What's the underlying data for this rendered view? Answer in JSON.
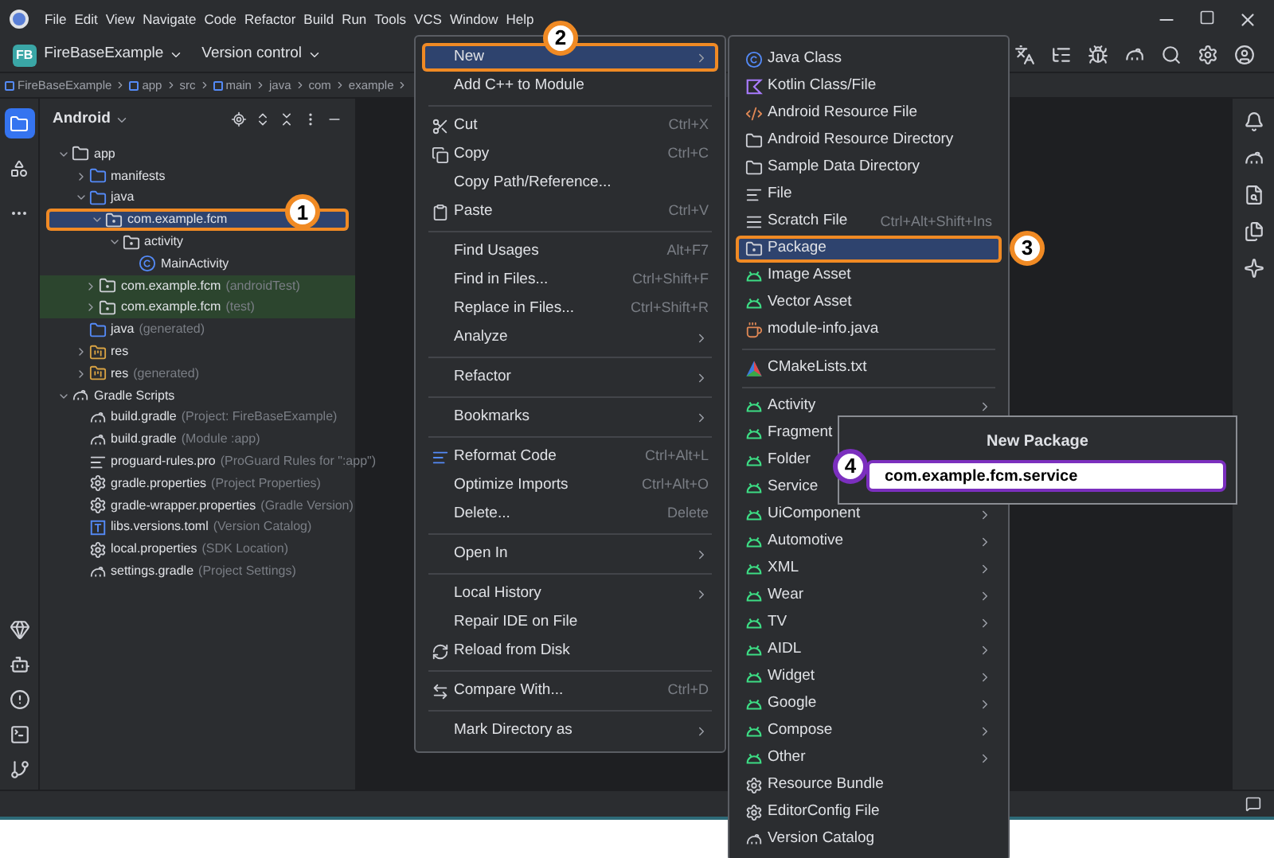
{
  "menu_bar": [
    "File",
    "Edit",
    "View",
    "Navigate",
    "Code",
    "Refactor",
    "Build",
    "Run",
    "Tools",
    "VCS",
    "Window",
    "Help"
  ],
  "toolbar": {
    "project_badge": "FB",
    "project": "FireBaseExample",
    "vcs": "Version control"
  },
  "breadcrumbs": [
    {
      "label": "FireBaseExample",
      "module": true
    },
    {
      "label": "app",
      "module": true
    },
    {
      "label": "src",
      "module": false
    },
    {
      "label": "main",
      "module": true
    },
    {
      "label": "java",
      "module": false
    },
    {
      "label": "com",
      "module": false
    },
    {
      "label": "example",
      "module": false
    }
  ],
  "left_toolbar": [
    {
      "kind": "project",
      "selected": true
    },
    {
      "kind": "structure",
      "selected": false
    },
    {
      "kind": "more",
      "selected": false
    }
  ],
  "project_panel": {
    "title": "Android",
    "tree": [
      {
        "label": "app",
        "kind": "module",
        "expanded": true,
        "children": [
          {
            "label": "manifests",
            "kind": "folder",
            "expanded": false
          },
          {
            "label": "java",
            "kind": "folder",
            "expanded": true,
            "children": [
              {
                "label": "com.example.fcm",
                "kind": "package",
                "expanded": true,
                "selected": true,
                "callout": {
                  "label": "1",
                  "color": "#f08a24"
                },
                "children": [
                  {
                    "label": "activity",
                    "kind": "package",
                    "expanded": true,
                    "children": [
                      {
                        "label": "MainActivity",
                        "kind": "class"
                      }
                    ]
                  }
                ]
              },
              {
                "label": "com.example.fcm",
                "hint": "(androidTest)",
                "kind": "package",
                "expanded": false,
                "highlighted": true
              },
              {
                "label": "com.example.fcm",
                "hint": "(test)",
                "kind": "package",
                "expanded": false,
                "highlighted": true
              }
            ]
          },
          {
            "label": "java",
            "hint": "(generated)",
            "kind": "folder"
          },
          {
            "label": "res",
            "kind": "res",
            "expanded": false
          },
          {
            "label": "res",
            "hint": "(generated)",
            "kind": "res",
            "expanded": false
          }
        ]
      },
      {
        "label": "Gradle Scripts",
        "kind": "gradle",
        "expanded": true,
        "children": [
          {
            "label": "build.gradle",
            "hint": "(Project: FireBaseExample)",
            "kind": "gradle"
          },
          {
            "label": "build.gradle",
            "hint": "(Module :app)",
            "kind": "gradle"
          },
          {
            "label": "proguard-rules.pro",
            "hint": "(ProGuard Rules for \":app\")",
            "kind": "file"
          },
          {
            "label": "gradle.properties",
            "hint": "(Project Properties)",
            "kind": "settings"
          },
          {
            "label": "gradle-wrapper.properties",
            "hint": "(Gradle Version)",
            "kind": "settings"
          },
          {
            "label": "libs.versions.toml",
            "hint": "(Version Catalog)",
            "kind": "toml"
          },
          {
            "label": "local.properties",
            "hint": "(SDK Location)",
            "kind": "settings"
          },
          {
            "label": "settings.gradle",
            "hint": "(Project Settings)",
            "kind": "gradle"
          }
        ]
      }
    ]
  },
  "context_menu": [
    {
      "kind": "plain",
      "label": "New",
      "submenu": true,
      "selected": true,
      "callout": {
        "label": "2",
        "color": "#f08a24"
      }
    },
    {
      "kind": "plain",
      "label": "Add C++ to Module"
    },
    {
      "kind": "separator"
    },
    {
      "kind": "cut",
      "label": "Cut",
      "shortcut": "Ctrl+X"
    },
    {
      "kind": "copy",
      "label": "Copy",
      "shortcut": "Ctrl+C"
    },
    {
      "kind": "plain",
      "label": "Copy Path/Reference..."
    },
    {
      "kind": "paste",
      "label": "Paste",
      "shortcut": "Ctrl+V"
    },
    {
      "kind": "separator"
    },
    {
      "kind": "plain",
      "label": "Find Usages",
      "shortcut": "Alt+F7"
    },
    {
      "kind": "plain",
      "label": "Find in Files...",
      "shortcut": "Ctrl+Shift+F"
    },
    {
      "kind": "plain",
      "label": "Replace in Files...",
      "shortcut": "Ctrl+Shift+R"
    },
    {
      "kind": "plain",
      "label": "Analyze",
      "submenu": true
    },
    {
      "kind": "separator"
    },
    {
      "kind": "plain",
      "label": "Refactor",
      "submenu": true
    },
    {
      "kind": "separator"
    },
    {
      "kind": "plain",
      "label": "Bookmarks",
      "submenu": true
    },
    {
      "kind": "separator"
    },
    {
      "kind": "reformat",
      "label": "Reformat Code",
      "shortcut": "Ctrl+Alt+L"
    },
    {
      "kind": "plain",
      "label": "Optimize Imports",
      "shortcut": "Ctrl+Alt+O"
    },
    {
      "kind": "plain",
      "label": "Delete...",
      "shortcut": "Delete"
    },
    {
      "kind": "separator"
    },
    {
      "kind": "plain",
      "label": "Open In",
      "submenu": true
    },
    {
      "kind": "separator"
    },
    {
      "kind": "plain",
      "label": "Local History",
      "submenu": true
    },
    {
      "kind": "plain",
      "label": "Repair IDE on File"
    },
    {
      "kind": "reload",
      "label": "Reload from Disk"
    },
    {
      "kind": "separator"
    },
    {
      "kind": "compare",
      "label": "Compare With...",
      "shortcut": "Ctrl+D"
    },
    {
      "kind": "separator"
    },
    {
      "kind": "plain",
      "label": "Mark Directory as",
      "submenu": true
    }
  ],
  "new_submenu": [
    {
      "kind": "class",
      "label": "Java Class"
    },
    {
      "kind": "kotlin",
      "label": "Kotlin Class/File"
    },
    {
      "kind": "code",
      "label": "Android Resource File"
    },
    {
      "kind": "folder-plain",
      "label": "Android Resource Directory"
    },
    {
      "kind": "folder-plain",
      "label": "Sample Data Directory"
    },
    {
      "kind": "file",
      "label": "File"
    },
    {
      "kind": "scratch",
      "label": "Scratch File",
      "shortcut": "Ctrl+Alt+Shift+Ins"
    },
    {
      "kind": "package",
      "label": "Package",
      "selected": true,
      "callout": {
        "label": "3",
        "color": "#f08a24"
      }
    },
    {
      "kind": "android",
      "label": "Image Asset"
    },
    {
      "kind": "android",
      "label": "Vector Asset"
    },
    {
      "kind": "cup",
      "label": "module-info.java"
    },
    {
      "kind": "separator"
    },
    {
      "kind": "cmake",
      "label": "CMakeLists.txt"
    },
    {
      "kind": "separator"
    },
    {
      "kind": "android",
      "label": "Activity",
      "submenu": true
    },
    {
      "kind": "android",
      "label": "Fragment"
    },
    {
      "kind": "android",
      "label": "Folder"
    },
    {
      "kind": "android",
      "label": "Service"
    },
    {
      "kind": "android",
      "label": "UiComponent",
      "submenu": true
    },
    {
      "kind": "android",
      "label": "Automotive",
      "submenu": true
    },
    {
      "kind": "android",
      "label": "XML",
      "submenu": true
    },
    {
      "kind": "android",
      "label": "Wear",
      "submenu": true
    },
    {
      "kind": "android",
      "label": "TV",
      "submenu": true
    },
    {
      "kind": "android",
      "label": "AIDL",
      "submenu": true
    },
    {
      "kind": "android",
      "label": "Widget",
      "submenu": true
    },
    {
      "kind": "android",
      "label": "Google",
      "submenu": true
    },
    {
      "kind": "android",
      "label": "Compose",
      "submenu": true
    },
    {
      "kind": "android",
      "label": "Other",
      "submenu": true
    },
    {
      "kind": "settings",
      "label": "Resource Bundle"
    },
    {
      "kind": "settings",
      "label": "EditorConfig File"
    },
    {
      "kind": "gradle",
      "label": "Version Catalog"
    }
  ],
  "new_package_dialog": {
    "title": "New Package",
    "value": "com.example.fcm.service",
    "callout": {
      "label": "4",
      "color": "#7b2fbe"
    }
  }
}
